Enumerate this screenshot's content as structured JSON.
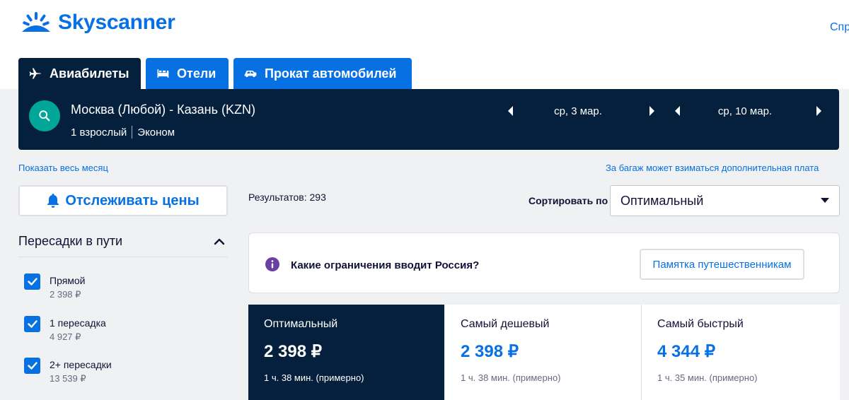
{
  "brand": {
    "name": "Skyscanner",
    "color": "#0770e3"
  },
  "header": {
    "help_link": "Спр"
  },
  "tabs": [
    {
      "label": "Авиабилеты",
      "icon": "plane-icon",
      "active": true
    },
    {
      "label": "Отели",
      "icon": "bed-icon",
      "active": false
    },
    {
      "label": "Прокат автомобилей",
      "icon": "car-icon",
      "active": false
    }
  ],
  "search": {
    "route": "Москва (Любой) - Казань (KZN)",
    "passengers": "1 взрослый",
    "cabin_class": "Эконом",
    "depart_date": "ср, 3 мар.",
    "return_date": "ср, 10 мар."
  },
  "links": {
    "show_month": "Показать весь месяц",
    "baggage_fee": "За багаж может взиматься дополнительная плата"
  },
  "track_prices": {
    "label": "Отслеживать цены"
  },
  "results": {
    "count_label": "Результатов: 293"
  },
  "sort": {
    "label": "Сортировать по",
    "selected": "Оптимальный"
  },
  "filters": {
    "stops": {
      "title": "Пересадки в пути",
      "options": [
        {
          "label": "Прямой",
          "price": "2 398 ₽",
          "checked": true
        },
        {
          "label": "1 пересадка",
          "price": "4 927 ₽",
          "checked": true
        },
        {
          "label": "2+ пересадки",
          "price": "13 539 ₽",
          "checked": true
        }
      ]
    }
  },
  "notice": {
    "text": "Какие ограничения вводит Россия?",
    "button": "Памятка путешественникам"
  },
  "sort_cards": [
    {
      "title": "Оптимальный",
      "price": "2 398 ₽",
      "duration": "1 ч. 38 мин. (примерно)",
      "active": true
    },
    {
      "title": "Самый дешевый",
      "price": "2 398 ₽",
      "duration": "1 ч. 38 мин. (примерно)",
      "active": false
    },
    {
      "title": "Самый быстрый",
      "price": "4 344 ₽",
      "duration": "1 ч. 35 мин. (примерно)",
      "active": false
    }
  ],
  "colors": {
    "navy": "#05203c",
    "blue": "#0770e3",
    "teal": "#00a698",
    "background": "#eff1f2",
    "info_purple": "#6b3fa0"
  }
}
